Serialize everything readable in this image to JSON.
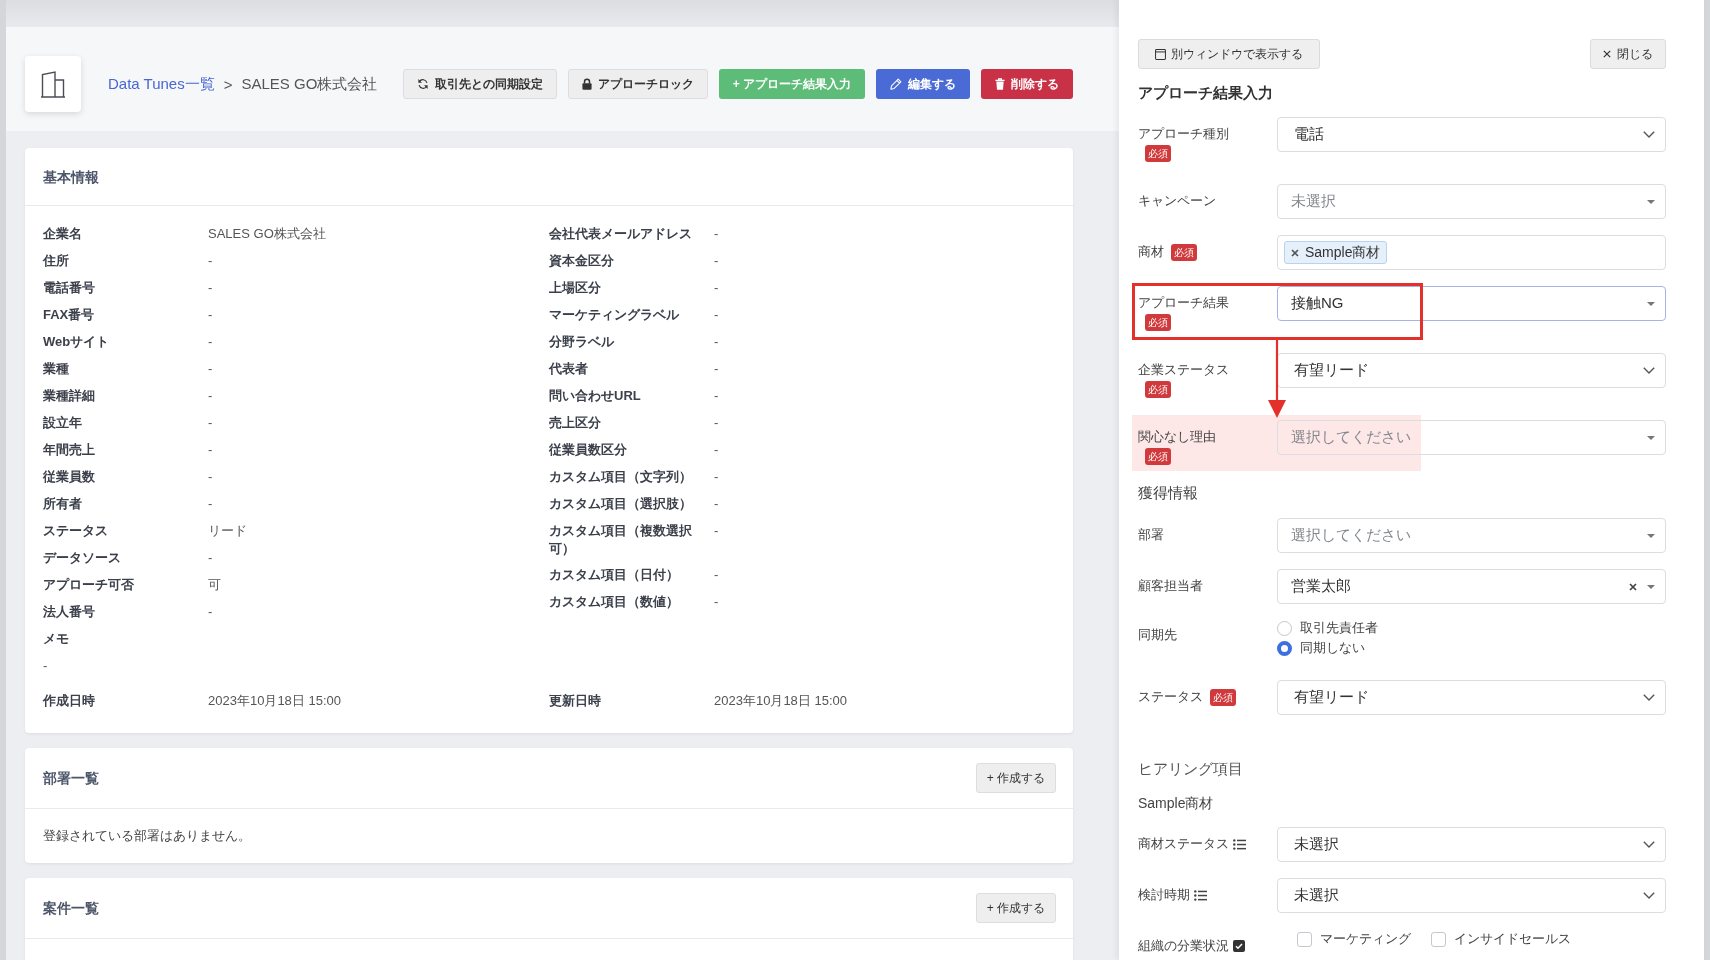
{
  "header": {
    "breadcrumb": [
      {
        "label": "Data Tunes一覧",
        "link": true
      },
      {
        "label": "SALES GO株式会社",
        "link": false
      }
    ],
    "separator": ">",
    "buttons": [
      {
        "label": "取引先との同期設定",
        "kind": "sync"
      },
      {
        "label": "アプローチロック",
        "kind": "lock"
      },
      {
        "label": "+ アプローチ結果入力",
        "kind": "add"
      },
      {
        "label": "編集する",
        "kind": "edit"
      },
      {
        "label": "削除する",
        "kind": "delete"
      }
    ]
  },
  "basic_info": {
    "title": "基本情報",
    "columns": [
      [
        {
          "label": "企業名",
          "value": "SALES GO株式会社"
        },
        {
          "label": "住所",
          "value": "-"
        },
        {
          "label": "電話番号",
          "value": "-"
        },
        {
          "label": "FAX番号",
          "value": "-"
        },
        {
          "label": "Webサイト",
          "value": "-"
        },
        {
          "label": "業種",
          "value": "-"
        },
        {
          "label": "業種詳細",
          "value": "-"
        },
        {
          "label": "設立年",
          "value": "-"
        },
        {
          "label": "年間売上",
          "value": "-"
        },
        {
          "label": "従業員数",
          "value": "-"
        },
        {
          "label": "所有者",
          "value": "-"
        },
        {
          "label": "ステータス",
          "value": "リード"
        },
        {
          "label": "データソース",
          "value": "-"
        },
        {
          "label": "アプローチ可否",
          "value": "可"
        },
        {
          "label": "法人番号",
          "value": "-"
        }
      ],
      [
        {
          "label": "会社代表メールアドレス",
          "value": "-"
        },
        {
          "label": "資本金区分",
          "value": "-"
        },
        {
          "label": "上場区分",
          "value": "-"
        },
        {
          "label": "マーケティングラベル",
          "value": "-"
        },
        {
          "label": "分野ラベル",
          "value": "-"
        },
        {
          "label": "代表者",
          "value": "-"
        },
        {
          "label": "問い合わせURL",
          "value": "-"
        },
        {
          "label": "売上区分",
          "value": "-"
        },
        {
          "label": "従業員数区分",
          "value": "-"
        },
        {
          "label": "カスタム項目（文字列）",
          "value": "-"
        },
        {
          "label": "カスタム項目（選択肢）",
          "value": "-"
        },
        {
          "label": "カスタム項目（複数選択可）",
          "value": "-"
        },
        {
          "label": "カスタム項目（日付）",
          "value": "-"
        },
        {
          "label": "カスタム項目（数値）",
          "value": "-"
        }
      ]
    ],
    "memo": {
      "label": "メモ",
      "value": "-"
    },
    "timestamps": [
      {
        "label": "作成日時",
        "value": "2023年10月18日 15:00"
      },
      {
        "label": "更新日時",
        "value": "2023年10月18日 15:00"
      }
    ]
  },
  "sections": [
    {
      "title": "部署一覧",
      "button": "+ 作成する",
      "empty_text": "登録されている部署はありません。"
    },
    {
      "title": "案件一覧",
      "button": "+ 作成する"
    }
  ],
  "side_panel": {
    "buttons": [
      {
        "label": "別ウィンドウで表示する",
        "kind": "popout"
      },
      {
        "label": "閉じる",
        "kind": "close"
      }
    ],
    "title": "アプローチ結果入力",
    "annotation_arrow": true,
    "items": [
      {
        "kind": "select",
        "label": "アプローチ種別",
        "required_badge": "必須",
        "value": "電話",
        "focused": false
      },
      {
        "kind": "combo",
        "label": "キャンペーン",
        "placeholder": "未選択",
        "focused": false
      },
      {
        "kind": "tags",
        "label": "商材",
        "required_badge": "必須",
        "tags": [
          "Sample商材"
        ]
      },
      {
        "kind": "combo",
        "label": "アプローチ結果",
        "required_badge": "必須",
        "value": "接触NG",
        "focused": true,
        "outlined": true
      },
      {
        "kind": "select",
        "label": "企業ステータス",
        "required_badge": "必須",
        "value": "有望リード",
        "focused": false
      },
      {
        "kind": "combo",
        "label": "関心なし理由",
        "required_badge": "必須",
        "placeholder": "選択してください",
        "focused": false,
        "highlighted": true
      },
      {
        "kind": "heading",
        "text": "獲得情報"
      },
      {
        "kind": "combo",
        "label": "部署",
        "placeholder": "選択してください",
        "focused": false
      },
      {
        "kind": "combo",
        "label": "顧客担当者",
        "value": "営業太郎",
        "clearable": true,
        "focused": false
      },
      {
        "kind": "radios",
        "label": "同期先",
        "options": [
          {
            "label": "取引先責任者",
            "selected": false
          },
          {
            "label": "同期しない",
            "selected": true
          }
        ]
      },
      {
        "kind": "select",
        "label": "ステータス",
        "required_badge": "必須",
        "value": "有望リード",
        "focused": false
      },
      {
        "kind": "section",
        "text": "ヒアリング項目"
      },
      {
        "kind": "subsection",
        "text": "Sample商材"
      },
      {
        "kind": "select",
        "label": "商材ステータス",
        "list_icon": true,
        "value": "未選択",
        "focused": false
      },
      {
        "kind": "select",
        "label": "検討時期",
        "list_icon": true,
        "value": "未選択",
        "focused": false
      },
      {
        "kind": "checks",
        "label": "組織の分業状況",
        "check_icon": true,
        "options": [
          {
            "label": "マーケティング",
            "checked": false
          },
          {
            "label": "インサイドセールス",
            "checked": false
          }
        ]
      }
    ]
  }
}
